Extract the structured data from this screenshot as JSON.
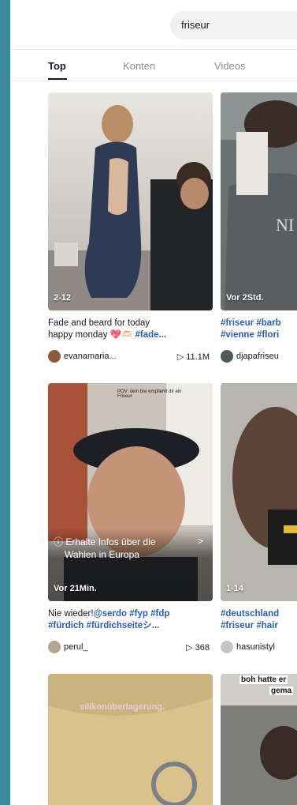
{
  "search": {
    "query": "friseur"
  },
  "tabs": [
    {
      "label": "Top",
      "active": true
    },
    {
      "label": "Konten",
      "active": false
    },
    {
      "label": "Videos",
      "active": false
    }
  ],
  "cards": [
    {
      "overlay": "2-12",
      "caption_line1": "Fade and beard for today",
      "caption_line2_text": "happy monday 💖🫶🏻 ",
      "caption_line2_tag": "#fade...",
      "user": "evanamaria...",
      "views": "▷ 11.1M"
    },
    {
      "overlay": "Vor 2Std.",
      "caption_line1": "#friseur #barb",
      "caption_line2_tag": "#vienne #flori",
      "user": "djapafriseu"
    },
    {
      "thumb_text": "POV: dein bre empfiehlt dir ein Friseur",
      "banner_line1": "ⓘ Erhalte Infos über die",
      "banner_line2": "Wahlen in Europa",
      "banner_chevron": ">",
      "overlay": "Vor 21Min.",
      "caption_line1_text": "Nie wieder!",
      "caption_line1_tag": "@serdo #fyp #fdp",
      "caption_line2_tag": "#fürdich #fürdichseiteシ...",
      "user": "perul_",
      "views": "▷ 368"
    },
    {
      "overlay": "1-14",
      "caption_line1": "#deutschland",
      "caption_line2_tag": "#friseur #hair",
      "user": "hasunistyl"
    },
    {
      "thumb_text": "silikonüberlagerung."
    },
    {
      "thumb_text_line1": "boh hatte er",
      "thumb_text_line2": "gema"
    }
  ],
  "colors": {
    "accent_tag": "#2b5db9",
    "text": "#161823",
    "muted": "#8a8b91",
    "frame": "#3a8a9a"
  }
}
